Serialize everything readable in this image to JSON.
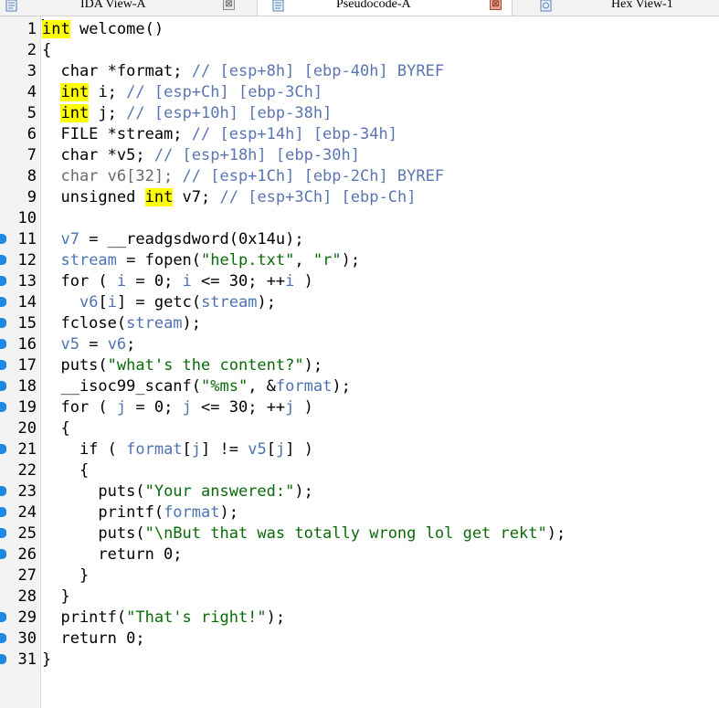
{
  "tabs": [
    {
      "label": "IDA View-A",
      "icon": "ida-view-icon",
      "close": "⊠"
    },
    {
      "label": "Pseudocode-A",
      "icon": "pseudocode-icon",
      "close": "⊠",
      "active": true
    },
    {
      "label": "Hex View-1",
      "icon": "hex-view-icon"
    }
  ],
  "colors": {
    "keyword_highlight": "#ffff00",
    "variable": "#4d73b1",
    "string": "#0a6a0a",
    "comment": "#5b75b1",
    "breakpoint": "#1e88e5"
  },
  "code": {
    "lines": [
      {
        "n": "1",
        "parts": [
          [
            "hl",
            "int"
          ],
          [
            "k",
            " welcome()"
          ]
        ]
      },
      {
        "n": "2",
        "parts": [
          [
            "k",
            "{"
          ]
        ]
      },
      {
        "n": "3",
        "parts": [
          [
            "k",
            "  char *format; "
          ],
          [
            "c",
            "// [esp+8h] [ebp-40h] BYREF"
          ]
        ]
      },
      {
        "n": "4",
        "parts": [
          [
            "k",
            "  "
          ],
          [
            "hl",
            "int"
          ],
          [
            "k",
            " i; "
          ],
          [
            "c",
            "// [esp+Ch] [ebp-3Ch]"
          ]
        ]
      },
      {
        "n": "5",
        "parts": [
          [
            "k",
            "  "
          ],
          [
            "hl",
            "int"
          ],
          [
            "k",
            " j; "
          ],
          [
            "c",
            "// [esp+10h] [ebp-38h]"
          ]
        ]
      },
      {
        "n": "6",
        "parts": [
          [
            "k",
            "  FILE *stream; "
          ],
          [
            "c",
            "// [esp+14h] [ebp-34h]"
          ]
        ]
      },
      {
        "n": "7",
        "parts": [
          [
            "k",
            "  char *v5; "
          ],
          [
            "c",
            "// [esp+18h] [ebp-30h]"
          ]
        ]
      },
      {
        "n": "8",
        "parts": [
          [
            "g",
            "  char v6[32]; "
          ],
          [
            "c",
            "// [esp+1Ch] [ebp-2Ch] BYREF"
          ]
        ]
      },
      {
        "n": "9",
        "parts": [
          [
            "k",
            "  unsigned "
          ],
          [
            "hl",
            "int"
          ],
          [
            "k",
            " v7; "
          ],
          [
            "c",
            "// [esp+3Ch] [ebp-Ch]"
          ]
        ]
      },
      {
        "n": "10",
        "parts": []
      },
      {
        "n": "11",
        "bp": true,
        "parts": [
          [
            "k",
            "  "
          ],
          [
            "v",
            "v7"
          ],
          [
            "k",
            " = __readgsdword(0x14u);"
          ]
        ]
      },
      {
        "n": "12",
        "bp": true,
        "parts": [
          [
            "k",
            "  "
          ],
          [
            "v",
            "stream"
          ],
          [
            "k",
            " = fopen("
          ],
          [
            "s",
            "\"help.txt\""
          ],
          [
            "k",
            ", "
          ],
          [
            "s",
            "\"r\""
          ],
          [
            "k",
            ");"
          ]
        ]
      },
      {
        "n": "13",
        "bp": true,
        "parts": [
          [
            "k",
            "  for ( "
          ],
          [
            "v",
            "i"
          ],
          [
            "k",
            " = 0; "
          ],
          [
            "v",
            "i"
          ],
          [
            "k",
            " <= 30; ++"
          ],
          [
            "v",
            "i"
          ],
          [
            "k",
            " )"
          ]
        ]
      },
      {
        "n": "14",
        "bp": true,
        "parts": [
          [
            "k",
            "    "
          ],
          [
            "v",
            "v6"
          ],
          [
            "k",
            "["
          ],
          [
            "v",
            "i"
          ],
          [
            "k",
            "] = getc("
          ],
          [
            "v",
            "stream"
          ],
          [
            "k",
            ");"
          ]
        ]
      },
      {
        "n": "15",
        "bp": true,
        "parts": [
          [
            "k",
            "  fclose("
          ],
          [
            "v",
            "stream"
          ],
          [
            "k",
            ");"
          ]
        ]
      },
      {
        "n": "16",
        "bp": true,
        "parts": [
          [
            "k",
            "  "
          ],
          [
            "v",
            "v5"
          ],
          [
            "k",
            " = "
          ],
          [
            "v",
            "v6"
          ],
          [
            "k",
            ";"
          ]
        ]
      },
      {
        "n": "17",
        "bp": true,
        "parts": [
          [
            "k",
            "  puts("
          ],
          [
            "s",
            "\"what's the content?\""
          ],
          [
            "k",
            ");"
          ]
        ]
      },
      {
        "n": "18",
        "bp": true,
        "parts": [
          [
            "k",
            "  __isoc99_scanf("
          ],
          [
            "s",
            "\"%ms\""
          ],
          [
            "k",
            ", &"
          ],
          [
            "v",
            "format"
          ],
          [
            "k",
            ");"
          ]
        ]
      },
      {
        "n": "19",
        "bp": true,
        "parts": [
          [
            "k",
            "  for ( "
          ],
          [
            "v",
            "j"
          ],
          [
            "k",
            " = 0; "
          ],
          [
            "v",
            "j"
          ],
          [
            "k",
            " <= 30; ++"
          ],
          [
            "v",
            "j"
          ],
          [
            "k",
            " )"
          ]
        ]
      },
      {
        "n": "20",
        "parts": [
          [
            "k",
            "  {"
          ]
        ]
      },
      {
        "n": "21",
        "bp": true,
        "parts": [
          [
            "k",
            "    if ( "
          ],
          [
            "v",
            "format"
          ],
          [
            "k",
            "["
          ],
          [
            "v",
            "j"
          ],
          [
            "k",
            "] != "
          ],
          [
            "v",
            "v5"
          ],
          [
            "k",
            "["
          ],
          [
            "v",
            "j"
          ],
          [
            "k",
            "] )"
          ]
        ]
      },
      {
        "n": "22",
        "parts": [
          [
            "k",
            "    {"
          ]
        ]
      },
      {
        "n": "23",
        "bp": true,
        "parts": [
          [
            "k",
            "      puts("
          ],
          [
            "s",
            "\"Your answered:\""
          ],
          [
            "k",
            ");"
          ]
        ]
      },
      {
        "n": "24",
        "bp": true,
        "parts": [
          [
            "k",
            "      printf("
          ],
          [
            "v",
            "format"
          ],
          [
            "k",
            ");"
          ]
        ]
      },
      {
        "n": "25",
        "bp": true,
        "parts": [
          [
            "k",
            "      puts("
          ],
          [
            "s",
            "\"\\nBut that was totally wrong lol get rekt\""
          ],
          [
            "k",
            ");"
          ]
        ]
      },
      {
        "n": "26",
        "bp": true,
        "parts": [
          [
            "k",
            "      return 0;"
          ]
        ]
      },
      {
        "n": "27",
        "parts": [
          [
            "k",
            "    }"
          ]
        ]
      },
      {
        "n": "28",
        "parts": [
          [
            "k",
            "  }"
          ]
        ]
      },
      {
        "n": "29",
        "bp": true,
        "parts": [
          [
            "k",
            "  printf("
          ],
          [
            "s",
            "\"That's right!\""
          ],
          [
            "k",
            ");"
          ]
        ]
      },
      {
        "n": "30",
        "bp": true,
        "parts": [
          [
            "k",
            "  return 0;"
          ]
        ]
      },
      {
        "n": "31",
        "bp": true,
        "parts": [
          [
            "k",
            "}"
          ]
        ]
      }
    ]
  }
}
